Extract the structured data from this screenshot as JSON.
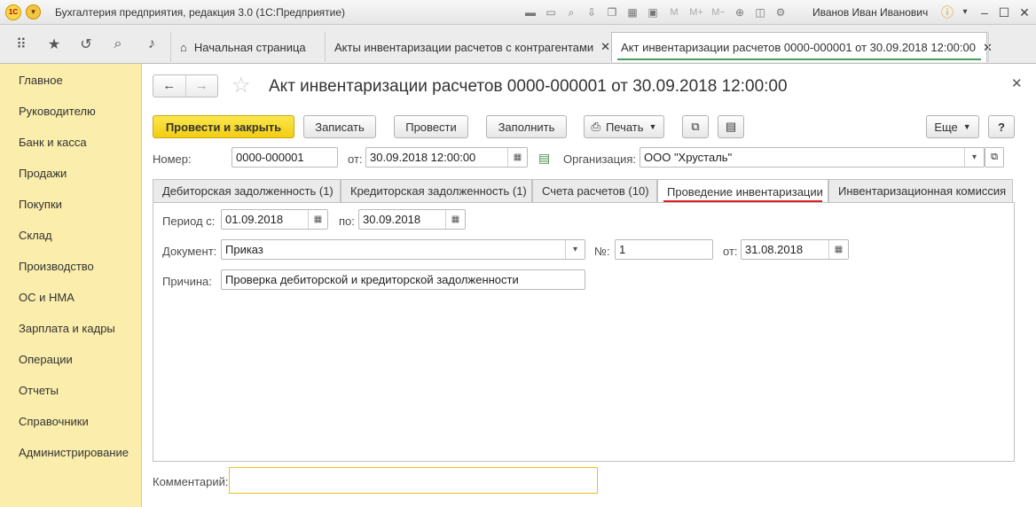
{
  "titlebar": {
    "app_title": "Бухгалтерия предприятия, редакция 3.0  (1С:Предприятие)",
    "logo_text": "1С",
    "user": "Иванов Иван Иванович"
  },
  "navbar": {
    "tabs": [
      {
        "label": "Начальная страница"
      },
      {
        "label": "Акты инвентаризации расчетов с контрагентами"
      },
      {
        "label": "Акт инвентаризации расчетов 0000-000001 от 30.09.2018 12:00:00"
      }
    ]
  },
  "sidebar": {
    "items": [
      {
        "label": "Главное"
      },
      {
        "label": "Руководителю"
      },
      {
        "label": "Банк и касса"
      },
      {
        "label": "Продажи"
      },
      {
        "label": "Покупки"
      },
      {
        "label": "Склад"
      },
      {
        "label": "Производство"
      },
      {
        "label": "ОС и НМА"
      },
      {
        "label": "Зарплата и кадры"
      },
      {
        "label": "Операции"
      },
      {
        "label": "Отчеты"
      },
      {
        "label": "Справочники"
      },
      {
        "label": "Администрирование"
      }
    ]
  },
  "document": {
    "title": "Акт инвентаризации расчетов 0000-000001 от 30.09.2018 12:00:00"
  },
  "toolbar": {
    "post_close": "Провести и закрыть",
    "save": "Записать",
    "post": "Провести",
    "fill": "Заполнить",
    "print": "Печать",
    "more": "Еще",
    "help": "?"
  },
  "header_fields": {
    "number_label": "Номер:",
    "number_value": "0000-000001",
    "date_label": "от:",
    "date_value": "30.09.2018 12:00:00",
    "org_label": "Организация:",
    "org_value": "ООО \"Хрусталь\""
  },
  "page_tabs": [
    {
      "label": "Дебиторская задолженность (1)"
    },
    {
      "label": "Кредиторская задолженность (1)"
    },
    {
      "label": "Счета расчетов (10)"
    },
    {
      "label": "Проведение инвентаризации"
    },
    {
      "label": "Инвентаризационная комиссия"
    }
  ],
  "inventory": {
    "period_label": "Период с:",
    "period_from": "01.09.2018",
    "period_to_label": "по:",
    "period_to": "30.09.2018",
    "document_label": "Документ:",
    "document_value": "Приказ",
    "num_label": "№:",
    "num_value": "1",
    "date_label": "от:",
    "date_value": "31.08.2018",
    "reason_label": "Причина:",
    "reason_value": "Проверка дебиторской и кредиторской задолженности"
  },
  "footer": {
    "comment_label": "Комментарий:",
    "comment_value": ""
  },
  "colors": {
    "sidebar_bg": "#fbedab",
    "primary_button": "#f2cd13",
    "active_tab_underline": "#4a9b5f",
    "active_page_tab_underline": "#e02020",
    "comment_border": "#f0c020"
  }
}
